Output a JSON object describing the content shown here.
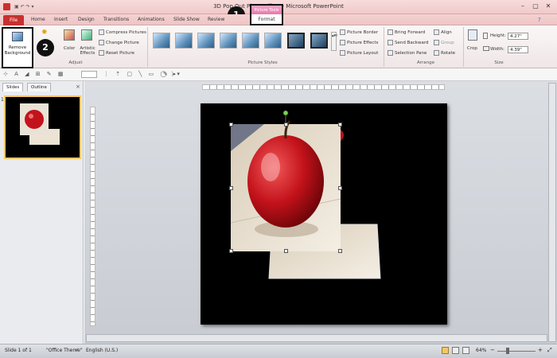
{
  "window": {
    "title": "3D Pop Out Photo Effect - Microsoft PowerPoint",
    "context_tab_group": "Picture Tools"
  },
  "tabs": [
    "File",
    "Home",
    "Insert",
    "Design",
    "Transitions",
    "Animations",
    "Slide Show",
    "Review",
    "View",
    "Format"
  ],
  "callouts": {
    "one": "1",
    "two": "2"
  },
  "ribbon": {
    "adjust": {
      "remove_background": "Remove Background",
      "corrections": "Corrections",
      "color": "Color",
      "artistic_effects": "Artistic Effects",
      "compress": "Compress Pictures",
      "change": "Change Picture",
      "reset": "Reset Picture",
      "group_label": "Adjust"
    },
    "picture_styles": {
      "group_label": "Picture Styles",
      "border": "Picture Border",
      "effects": "Picture Effects",
      "layout": "Picture Layout"
    },
    "arrange": {
      "group_label": "Arrange",
      "bring_forward": "Bring Forward",
      "send_backward": "Send Backward",
      "selection_pane": "Selection Pane",
      "align": "Align",
      "group": "Group",
      "rotate": "Rotate"
    },
    "size": {
      "group_label": "Size",
      "crop": "Crop",
      "height_label": "Height:",
      "height_value": "4.27\"",
      "width_label": "Width:",
      "width_value": "4.39\""
    }
  },
  "sidepane": {
    "tabs": [
      "Slides",
      "Outline"
    ],
    "slide_number": "1",
    "close": "×"
  },
  "status": {
    "slide": "Slide 1 of 1",
    "theme": "\"Office Theme\"",
    "language": "English (U.S.)",
    "zoom": "64%"
  },
  "colors": {
    "file_tab": "#c8302f",
    "context_tab": "#e87aa9",
    "slide_bg": "#000000",
    "apple_red": "#c4121b"
  }
}
